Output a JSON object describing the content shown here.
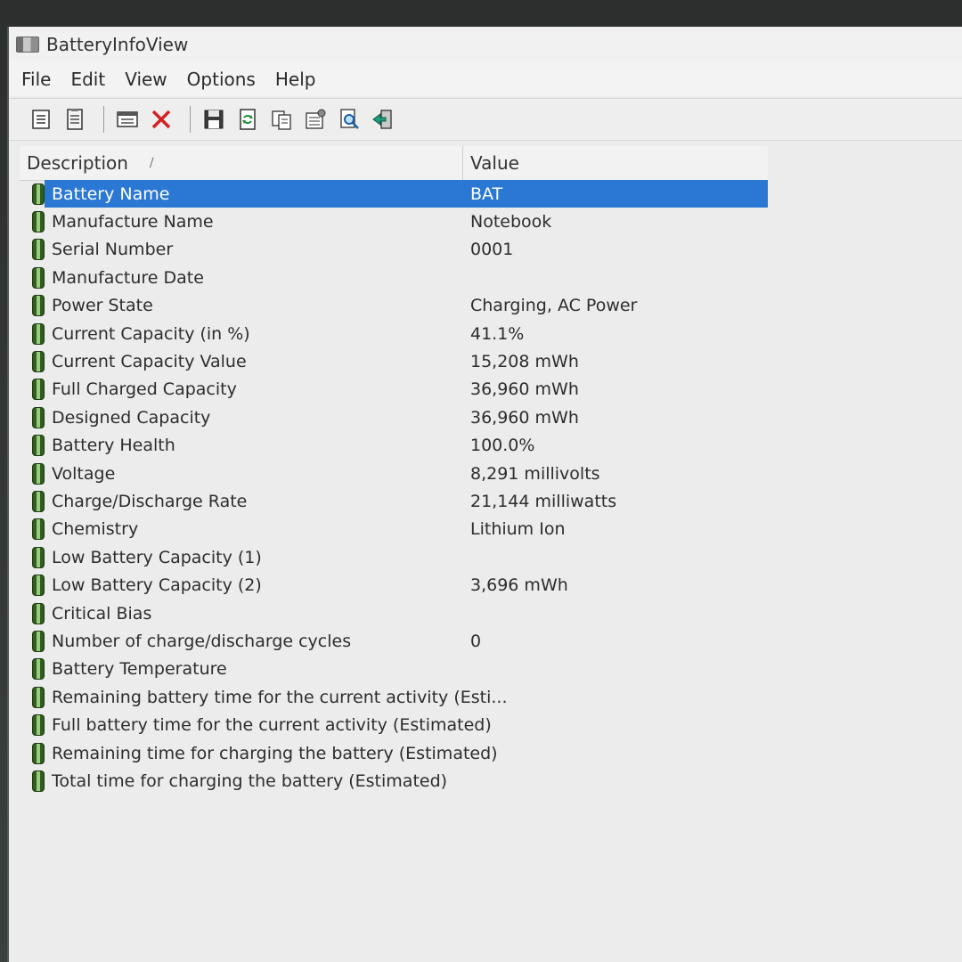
{
  "window": {
    "title": "BatteryInfoView"
  },
  "menu": [
    "File",
    "Edit",
    "View",
    "Options",
    "Help"
  ],
  "toolbar": {
    "buttons": [
      "properties-icon",
      "html-report-icon",
      "advanced-options-icon",
      "delete-icon",
      "save-icon",
      "refresh-icon",
      "copy-icon",
      "options-icon",
      "find-icon",
      "exit-icon"
    ]
  },
  "columns": {
    "description": "Description",
    "value": "Value"
  },
  "rows": [
    {
      "label": "Battery Name",
      "value": "BAT",
      "selected": true
    },
    {
      "label": "Manufacture Name",
      "value": "Notebook"
    },
    {
      "label": "Serial Number",
      "value": "0001"
    },
    {
      "label": "Manufacture Date",
      "value": ""
    },
    {
      "label": "Power State",
      "value": "Charging, AC Power"
    },
    {
      "label": "Current Capacity (in %)",
      "value": "41.1%"
    },
    {
      "label": "Current Capacity Value",
      "value": "15,208 mWh"
    },
    {
      "label": "Full Charged Capacity",
      "value": "36,960 mWh"
    },
    {
      "label": "Designed Capacity",
      "value": "36,960 mWh"
    },
    {
      "label": "Battery Health",
      "value": "100.0%"
    },
    {
      "label": "Voltage",
      "value": "8,291 millivolts"
    },
    {
      "label": "Charge/Discharge Rate",
      "value": "21,144 milliwatts"
    },
    {
      "label": "Chemistry",
      "value": "Lithium Ion"
    },
    {
      "label": "Low Battery Capacity (1)",
      "value": ""
    },
    {
      "label": "Low Battery Capacity (2)",
      "value": "3,696 mWh"
    },
    {
      "label": "Critical Bias",
      "value": ""
    },
    {
      "label": "Number of charge/discharge cycles",
      "value": "0"
    },
    {
      "label": "Battery Temperature",
      "value": ""
    },
    {
      "label": "Remaining battery time for the current activity (Esti...",
      "value": ""
    },
    {
      "label": "Full battery time for the current activity (Estimated)",
      "value": ""
    },
    {
      "label": "Remaining time for charging the battery (Estimated)",
      "value": ""
    },
    {
      "label": "Total  time for charging the battery (Estimated)",
      "value": ""
    }
  ]
}
